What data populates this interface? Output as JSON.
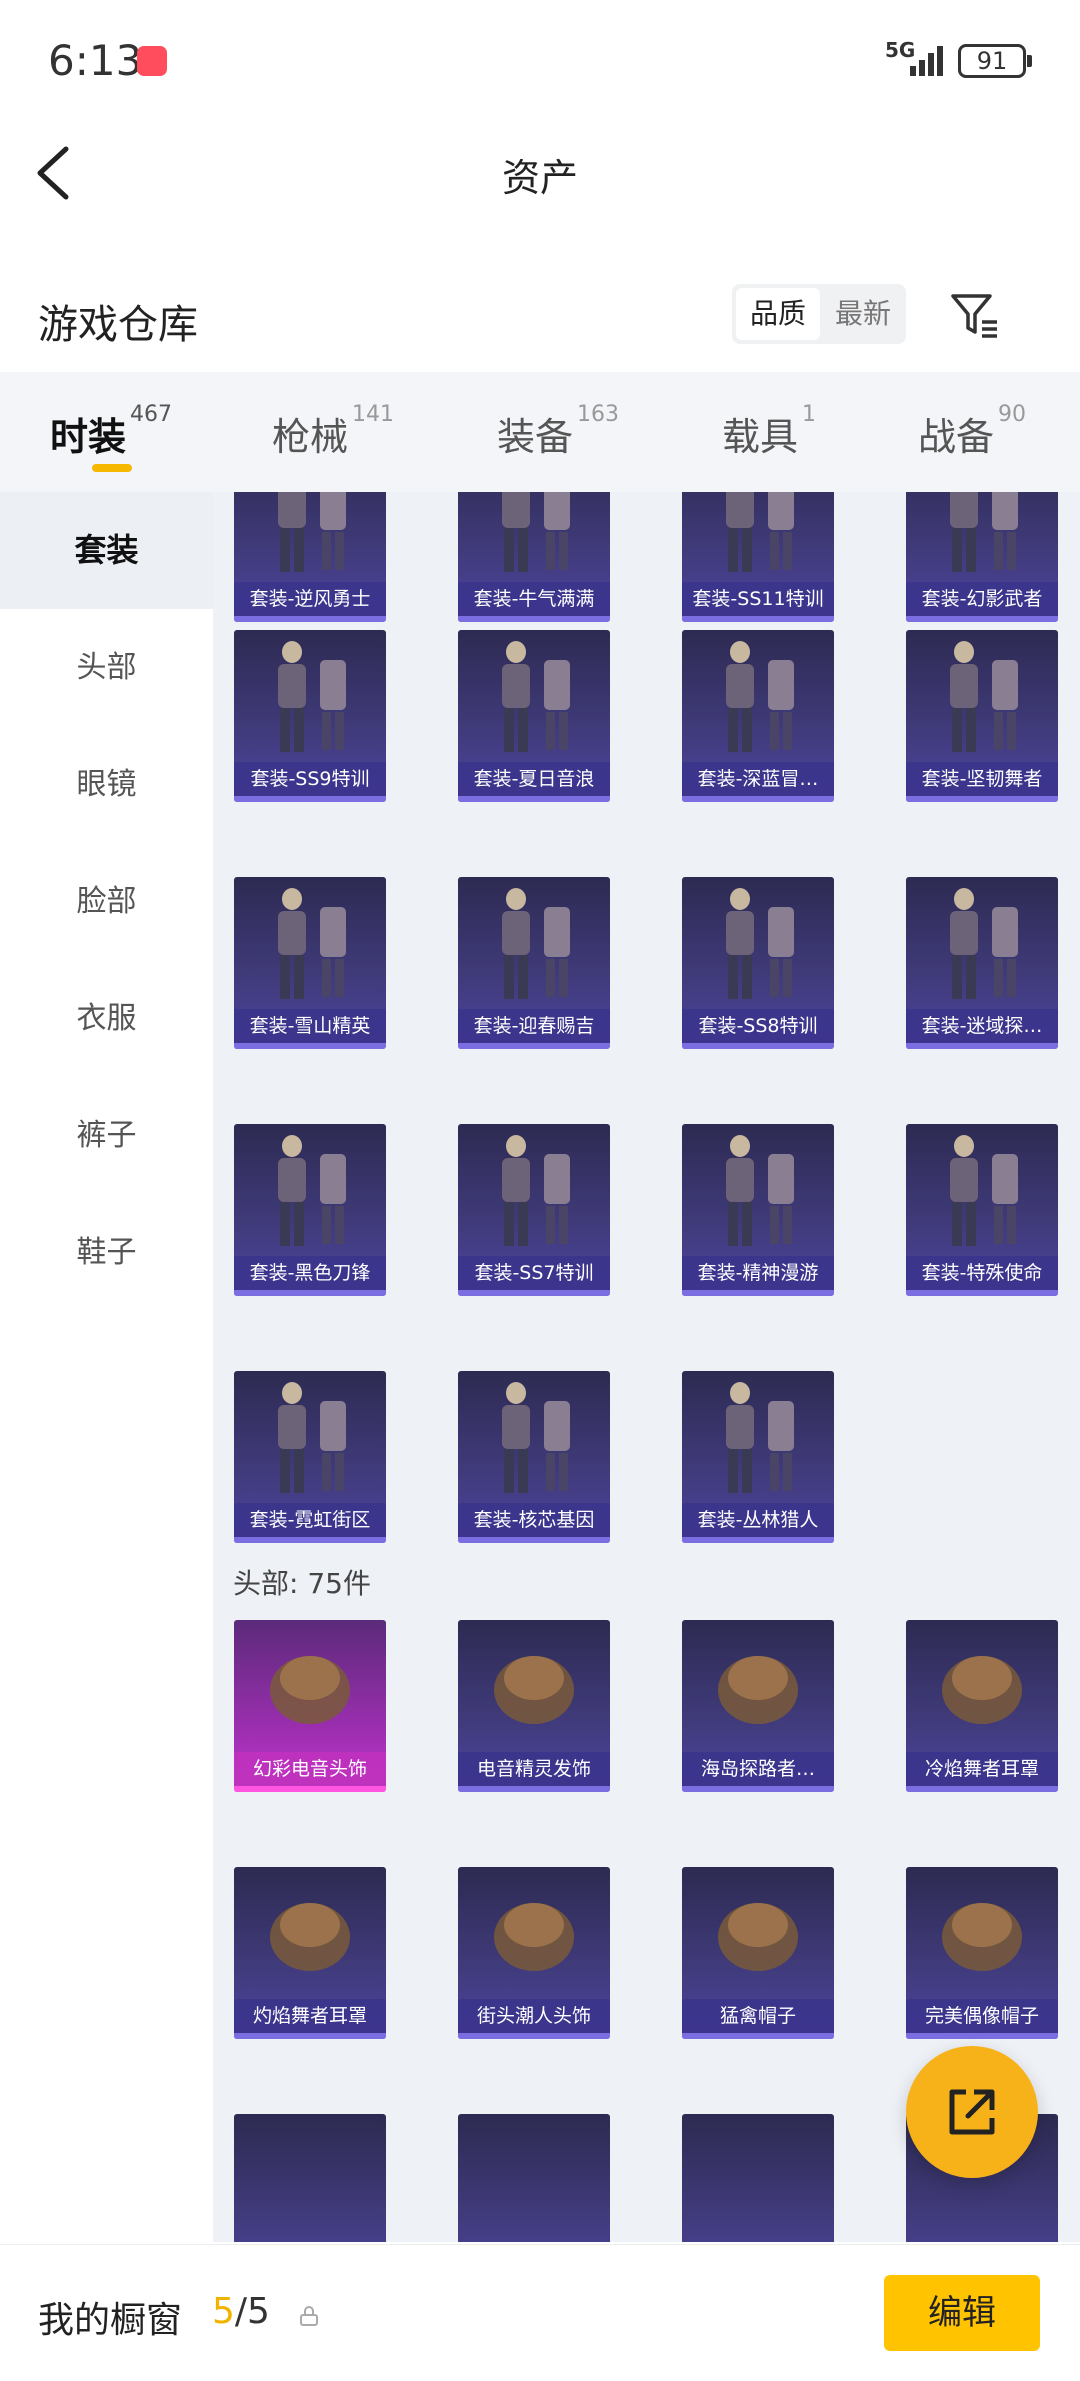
{
  "status": {
    "time": "6:13",
    "network": "5G",
    "battery": "91"
  },
  "nav": {
    "title": "资产"
  },
  "header": {
    "title": "游戏仓库",
    "sort_options": [
      "品质",
      "最新"
    ]
  },
  "tabs": [
    {
      "label": "时装",
      "count": "467"
    },
    {
      "label": "枪械",
      "count": "141"
    },
    {
      "label": "装备",
      "count": "163"
    },
    {
      "label": "载具",
      "count": "1"
    },
    {
      "label": "战备",
      "count": "90"
    }
  ],
  "sidebar": [
    "套装",
    "头部",
    "眼镜",
    "脸部",
    "衣服",
    "裤子",
    "鞋子"
  ],
  "suits": [
    "套装-逆风勇士",
    "套装-牛气满满",
    "套装-SS11特训",
    "套装-幻影武者",
    "套装-SS9特训",
    "套装-夏日音浪",
    "套装-深蓝冒…",
    "套装-坚韧舞者",
    "套装-雪山精英",
    "套装-迎春赐吉",
    "套装-SS8特训",
    "套装-迷域探…",
    "套装-黑色刀锋",
    "套装-SS7特训",
    "套装-精神漫游",
    "套装-特殊使命",
    "套装-霓虹街区",
    "套装-核芯基因",
    "套装-丛林猎人"
  ],
  "head_section": {
    "title": "头部: 75件",
    "items": [
      "幻彩电音头饰",
      "电音精灵发饰",
      "海岛探路者…",
      "冷焰舞者耳罩",
      "灼焰舞者耳罩",
      "街头潮人头饰",
      "猛禽帽子",
      "完美偶像帽子",
      "",
      "",
      "",
      ""
    ]
  },
  "bottom": {
    "label": "我的橱窗",
    "current": "5",
    "total": "/5",
    "edit_label": "编辑"
  },
  "colors": {
    "accent": "#f6b800",
    "card_bg": "#3f3a78",
    "card_pink": "#c43dcb"
  },
  "icons": [
    "back-icon",
    "filter-icon",
    "share-icon",
    "lock-icon"
  ]
}
